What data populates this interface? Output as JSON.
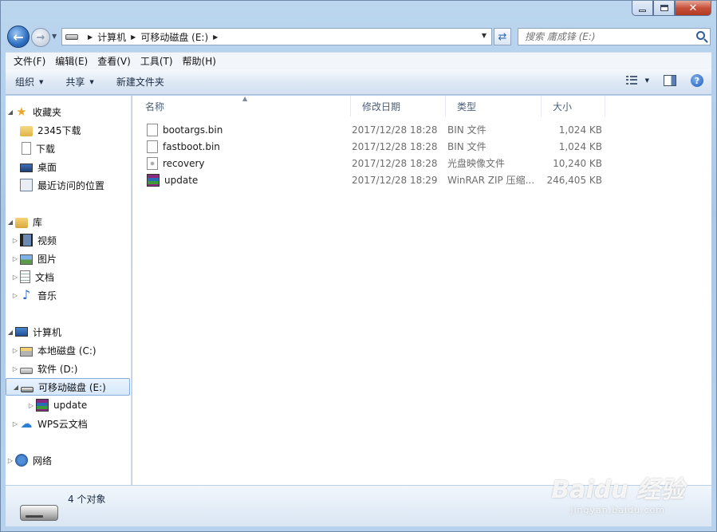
{
  "window": {
    "minimize": "—",
    "maximize": "□",
    "close": "✕"
  },
  "nav": {
    "breadcrumb": [
      "计算机",
      "可移动磁盘 (E:)"
    ],
    "search_placeholder": "搜索 庸成锋 (E:)"
  },
  "menubar": [
    "文件(F)",
    "编辑(E)",
    "查看(V)",
    "工具(T)",
    "帮助(H)"
  ],
  "toolbar": {
    "organize": "组织",
    "share": "共享",
    "new_folder": "新建文件夹"
  },
  "sidebar": {
    "favorites": {
      "label": "收藏夹",
      "items": [
        "2345下载",
        "下载",
        "桌面",
        "最近访问的位置"
      ]
    },
    "libraries": {
      "label": "库",
      "items": [
        "视频",
        "图片",
        "文档",
        "音乐"
      ]
    },
    "computer": {
      "label": "计算机",
      "items": [
        "本地磁盘 (C:)",
        "软件 (D:)",
        "可移动磁盘 (E:)",
        "update",
        "WPS云文档"
      ]
    },
    "network": {
      "label": "网络"
    }
  },
  "columns": {
    "name": "名称",
    "date": "修改日期",
    "type": "类型",
    "size": "大小"
  },
  "files": [
    {
      "name": "bootargs.bin",
      "date": "2017/12/28 18:28",
      "type": "BIN 文件",
      "size": "1,024 KB",
      "icon": "bin-file-icon"
    },
    {
      "name": "fastboot.bin",
      "date": "2017/12/28 18:28",
      "type": "BIN 文件",
      "size": "1,024 KB",
      "icon": "bin-file-icon"
    },
    {
      "name": "recovery",
      "date": "2017/12/28 18:28",
      "type": "光盘映像文件",
      "size": "10,240 KB",
      "icon": "disc-image-icon"
    },
    {
      "name": "update",
      "date": "2017/12/28 18:29",
      "type": "WinRAR ZIP 压缩...",
      "size": "246,405 KB",
      "icon": "winrar-archive-icon"
    }
  ],
  "details": {
    "count": "4 个对象"
  },
  "watermark": {
    "main": "Baidu 经验",
    "sub": "jingyan.baidu.com"
  }
}
